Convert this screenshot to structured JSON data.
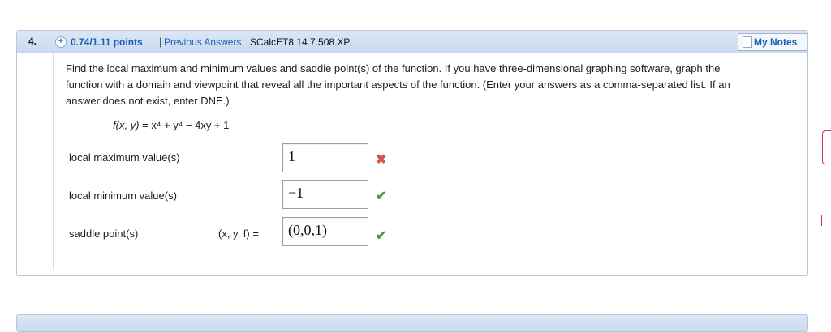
{
  "question": {
    "number": "4.",
    "points": "0.74/1.11 points",
    "separator": "|",
    "previous_answers": "Previous Answers",
    "reference": "SCalcET8 14.7.508.XP.",
    "my_notes": "My Notes"
  },
  "prompt": "Find the local maximum and minimum values and saddle point(s) of the function. If you have three-dimensional graphing software, graph the function with a domain and viewpoint that reveal all the important aspects of the function. (Enter your answers as a comma-separated list. If an answer does not exist, enter DNE.)",
  "function_text": {
    "lhs": "f(x, y)",
    "rhs": " = x⁴ + y⁴ − 4xy + 1"
  },
  "answers": [
    {
      "label": "local maximum value(s)",
      "value": "1",
      "status": "incorrect",
      "mark": "✖"
    },
    {
      "label": "local minimum value(s)",
      "value": "−1",
      "status": "correct",
      "mark": "✔"
    },
    {
      "label": "saddle point(s)",
      "prefix": "(x, y, f)  =",
      "value": "(0,0,1)",
      "status": "correct",
      "mark": "✔"
    }
  ],
  "colors": {
    "link": "#1f5fb0",
    "incorrect": "#d9534f",
    "correct": "#3f9b4b",
    "header_bg": "#c9daf0"
  }
}
